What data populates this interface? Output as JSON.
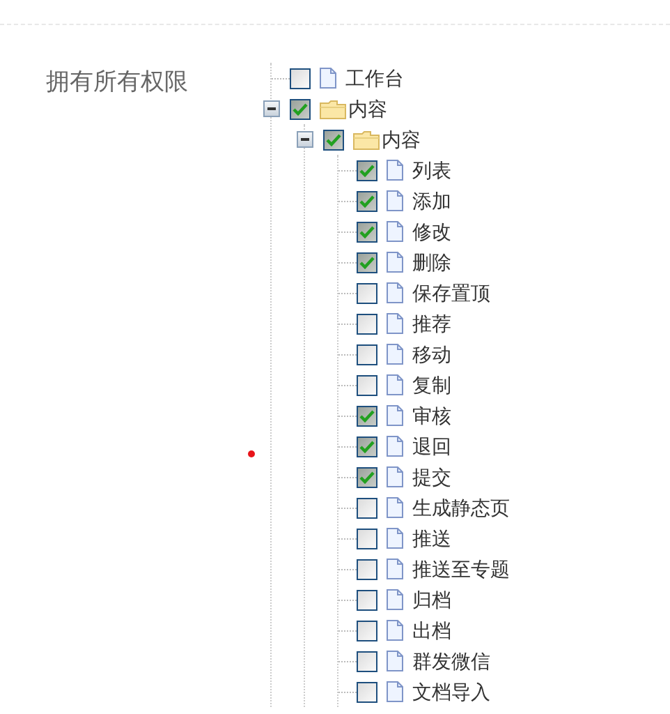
{
  "label": "拥有所有权限",
  "tree": [
    {
      "label": "工作台",
      "kind": "file",
      "checked": false
    },
    {
      "label": "内容",
      "kind": "folder",
      "checked": true,
      "expanded": true,
      "children": [
        {
          "label": "内容",
          "kind": "folder",
          "checked": true,
          "expanded": true,
          "children": [
            {
              "label": "列表",
              "kind": "file",
              "checked": true
            },
            {
              "label": "添加",
              "kind": "file",
              "checked": true
            },
            {
              "label": "修改",
              "kind": "file",
              "checked": true
            },
            {
              "label": "删除",
              "kind": "file",
              "checked": true
            },
            {
              "label": "保存置顶",
              "kind": "file",
              "checked": false
            },
            {
              "label": "推荐",
              "kind": "file",
              "checked": false
            },
            {
              "label": "移动",
              "kind": "file",
              "checked": false
            },
            {
              "label": "复制",
              "kind": "file",
              "checked": false
            },
            {
              "label": "审核",
              "kind": "file",
              "checked": true
            },
            {
              "label": "退回",
              "kind": "file",
              "checked": true
            },
            {
              "label": "提交",
              "kind": "file",
              "checked": true
            },
            {
              "label": "生成静态页",
              "kind": "file",
              "checked": false
            },
            {
              "label": "推送",
              "kind": "file",
              "checked": false
            },
            {
              "label": "推送至专题",
              "kind": "file",
              "checked": false
            },
            {
              "label": "归档",
              "kind": "file",
              "checked": false
            },
            {
              "label": "出档",
              "kind": "file",
              "checked": false
            },
            {
              "label": "群发微信",
              "kind": "file",
              "checked": false
            },
            {
              "label": "文档导入",
              "kind": "file",
              "checked": false
            }
          ]
        }
      ]
    }
  ]
}
